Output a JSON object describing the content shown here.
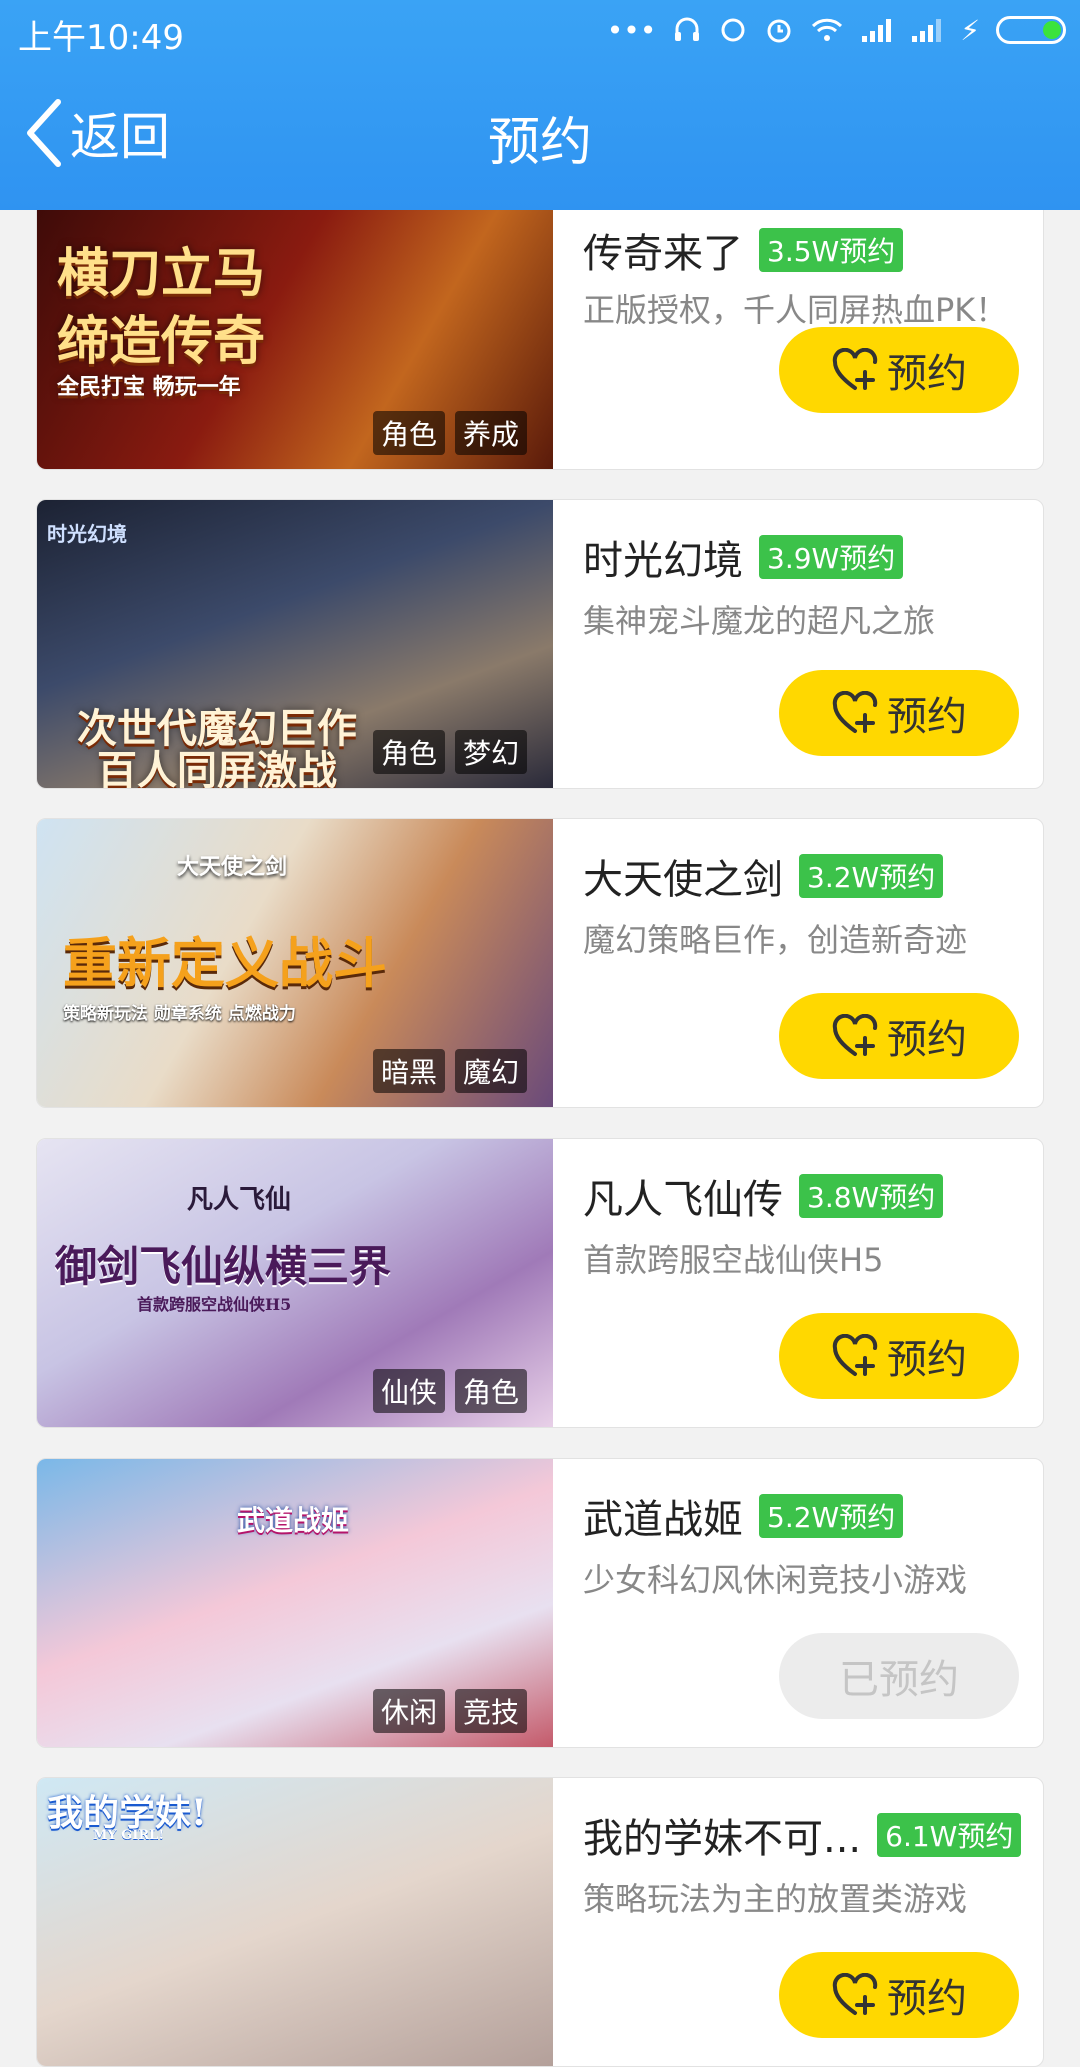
{
  "status": {
    "time": "上午10:49"
  },
  "nav": {
    "back_label": "返回",
    "title": "预约"
  },
  "colors": {
    "topbar": "#2f93f1",
    "button": "#ffd800",
    "badge": "#3cc24a",
    "disabled": "#ececec"
  },
  "games": [
    {
      "title": "传奇来了",
      "count": "3.5W预约",
      "desc": "正版授权，千人同屏热血PK！",
      "tags": [
        "角色",
        "养成"
      ],
      "button": "预约",
      "reserved": false,
      "art_lines": [
        "横刀立马",
        "缔造传奇",
        "全民打宝  畅玩一年"
      ]
    },
    {
      "title": "时光幻境",
      "count": "3.9W预约",
      "desc": "集神宠斗魔龙的超凡之旅",
      "tags": [
        "角色",
        "梦幻"
      ],
      "button": "预约",
      "reserved": false,
      "art_lines": [
        "次世代魔幻巨作",
        "百人同屏激战",
        "时光幻境"
      ]
    },
    {
      "title": "大天使之剑",
      "count": "3.2W预约",
      "desc": "魔幻策略巨作，创造新奇迹",
      "tags": [
        "暗黑",
        "魔幻"
      ],
      "button": "预约",
      "reserved": false,
      "art_lines": [
        "大天使之剑",
        "重新定义战斗",
        "策略新玩法  勋章系统  点燃战力"
      ]
    },
    {
      "title": "凡人飞仙传",
      "count": "3.8W预约",
      "desc": "首款跨服空战仙侠H5",
      "tags": [
        "仙侠",
        "角色"
      ],
      "button": "预约",
      "reserved": false,
      "art_lines": [
        "凡人飞仙",
        "御剑飞仙纵横三界",
        "首款跨服空战仙侠H5"
      ]
    },
    {
      "title": "武道战姬",
      "count": "5.2W预约",
      "desc": "少女科幻风休闲竞技小游戏",
      "tags": [
        "休闲",
        "竞技"
      ],
      "button": "已预约",
      "reserved": true,
      "art_lines": [
        "武道战姬"
      ]
    },
    {
      "title": "我的学妹不可...",
      "count": "6.1W预约",
      "desc": "策略玩法为主的放置类游戏",
      "tags": [],
      "button": "预约",
      "reserved": false,
      "art_lines": [
        "我的学妹!",
        "MY GIRL!"
      ]
    }
  ]
}
